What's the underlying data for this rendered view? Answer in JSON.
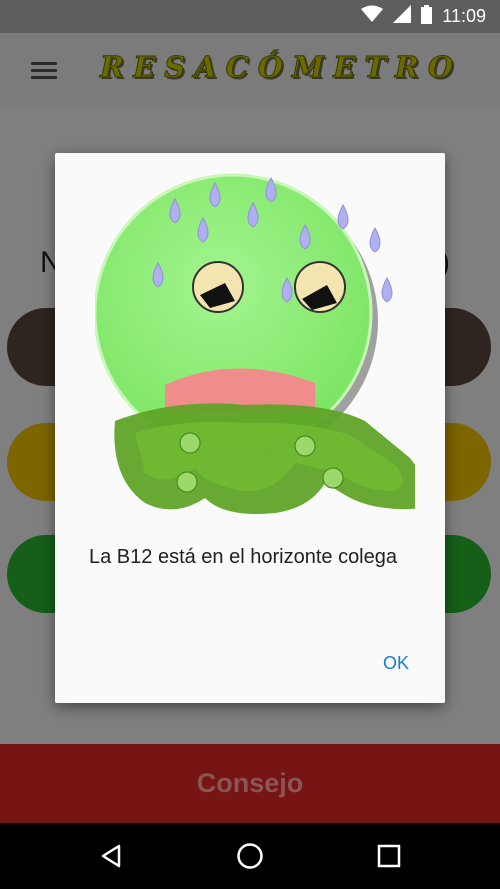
{
  "status_bar": {
    "time": "11:09"
  },
  "app_bar": {
    "title": "RESACÓMETRO"
  },
  "background": {
    "heading_left": "N",
    "heading_right": ")"
  },
  "dialog": {
    "message": "La B12 está en el horizonte colega",
    "ok_label": "OK"
  },
  "bottom_bar": {
    "consejo_label": "Consejo"
  },
  "colors": {
    "accent": "#1c7bd6",
    "consejo": "#761514",
    "face": "#90ef7c"
  }
}
